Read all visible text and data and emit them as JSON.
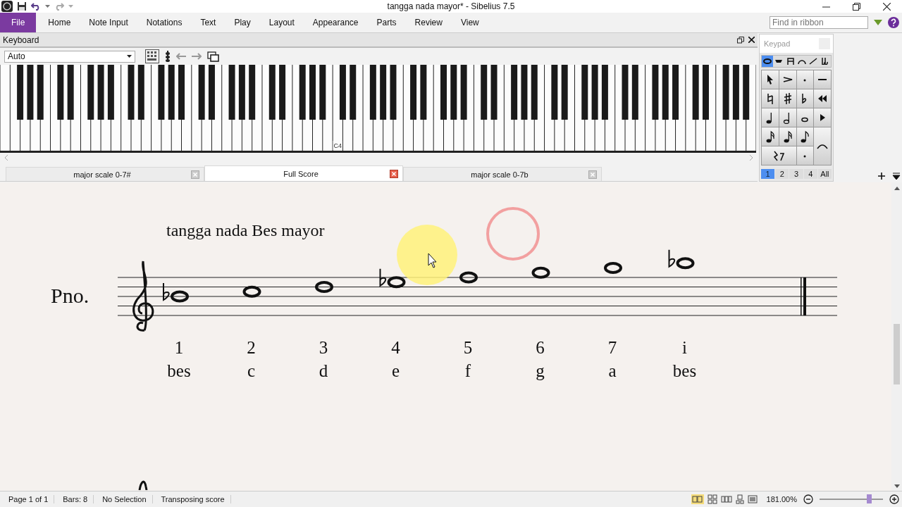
{
  "window": {
    "title": "tangga nada mayor* - Sibelius 7.5"
  },
  "ribbon": {
    "tabs": [
      {
        "label": "File",
        "selected": true
      },
      {
        "label": "Home",
        "selected": false
      },
      {
        "label": "Note Input",
        "selected": false
      },
      {
        "label": "Notations",
        "selected": false
      },
      {
        "label": "Text",
        "selected": false
      },
      {
        "label": "Play",
        "selected": false
      },
      {
        "label": "Layout",
        "selected": false
      },
      {
        "label": "Appearance",
        "selected": false
      },
      {
        "label": "Parts",
        "selected": false
      },
      {
        "label": "Review",
        "selected": false
      },
      {
        "label": "View",
        "selected": false
      }
    ],
    "search": {
      "placeholder": "Find in ribbon"
    }
  },
  "keyboard_panel": {
    "title": "Keyboard",
    "mode": "Auto",
    "key_label": "C4"
  },
  "keypad": {
    "title": "Keypad",
    "tabs": [
      {
        "selected": true
      },
      {
        "selected": false
      },
      {
        "selected": false
      },
      {
        "selected": false
      },
      {
        "selected": false
      },
      {
        "selected": false
      }
    ],
    "layers": [
      {
        "label": "1",
        "selected": true
      },
      {
        "label": "2",
        "selected": false
      },
      {
        "label": "3",
        "selected": false
      },
      {
        "label": "4",
        "selected": false
      },
      {
        "label": "All",
        "selected": false
      }
    ]
  },
  "document_tabs": [
    {
      "label": "major scale 0-7#",
      "selected": false
    },
    {
      "label": "Full Score",
      "selected": true
    },
    {
      "label": "major scale 0-7b",
      "selected": false
    }
  ],
  "score": {
    "title": "tangga nada Bes mayor",
    "instrument": "Pno.",
    "notes": [
      {
        "number": "1",
        "syllable": "bes",
        "flat": true
      },
      {
        "number": "2",
        "syllable": "c",
        "flat": false
      },
      {
        "number": "3",
        "syllable": "d",
        "flat": false
      },
      {
        "number": "4",
        "syllable": "e",
        "flat": true
      },
      {
        "number": "5",
        "syllable": "f",
        "flat": false
      },
      {
        "number": "6",
        "syllable": "g",
        "flat": false
      },
      {
        "number": "7",
        "syllable": "a",
        "flat": false
      },
      {
        "number": "i",
        "syllable": "bes",
        "flat": true
      }
    ]
  },
  "status_bar": {
    "items": [
      "Page 1 of 1",
      "Bars: 8",
      "No Selection",
      "Transposing score"
    ],
    "zoom": "181.00%",
    "zoom_slider": {
      "level": 0.78
    }
  }
}
